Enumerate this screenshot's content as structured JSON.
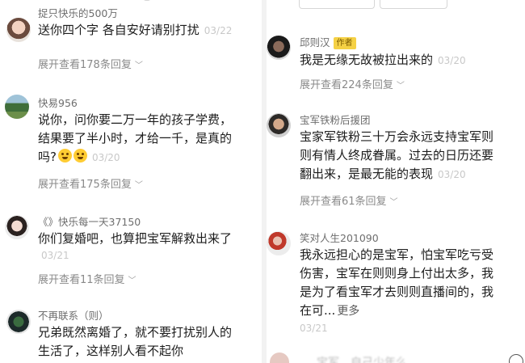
{
  "left": {
    "comments": [
      {
        "username": "捉只快乐的500万",
        "lines": [
          "送你四个字 各自安好请别打扰"
        ],
        "date": "03/22",
        "expand": "展开查看178条回复"
      },
      {
        "username": "快易956",
        "lines": [
          "说你，问你要二万一年的孩子学费，",
          "结果要了半小时，才给一千，是真的",
          "吗?"
        ],
        "date": "03/20",
        "expand": "展开查看175条回复"
      },
      {
        "username": "《》快乐每一天37150",
        "lines": [
          "你们复婚吧，也算把宝军解救出来了"
        ],
        "date": "03/21",
        "expand": "展开查看11条回复"
      },
      {
        "username": "不再联系（则）",
        "lines": [
          "兄弟既然离婚了，就不要打扰别人的",
          "生活了，这样别人看不起你"
        ]
      }
    ]
  },
  "right": {
    "comments": [
      {
        "username": "邱则汉",
        "badge": "作者",
        "lines": [
          "我是无缘无故被拉出来的"
        ],
        "date": "03/20",
        "expand": "展开查看224条回复"
      },
      {
        "username": "宝军铁粉后援团",
        "lines": [
          "宝家军铁粉三十万会永远支持宝军则",
          "则有情人终成眷属。过去的日历还要",
          "翻出来，是最无能的表现"
        ],
        "date": "03/20",
        "expand": "展开查看61条回复"
      },
      {
        "username": "笑对人生201090",
        "lines": [
          "我永远担心的是宝军，怕宝军吃亏受",
          "伤害，宝军在则则身上付出太多，我",
          "是为了看宝军才去则则直播间的，我",
          "在可..."
        ],
        "more": "更多",
        "date": "03/21"
      }
    ],
    "bottom_partial": "…宝军…自己少年么"
  },
  "colors": {
    "username": "#6e6e6e",
    "body_text": "#1c1c1c",
    "date": "#c8c8c8",
    "expand": "#8a8a8a",
    "author_badge": "#f5d145"
  }
}
